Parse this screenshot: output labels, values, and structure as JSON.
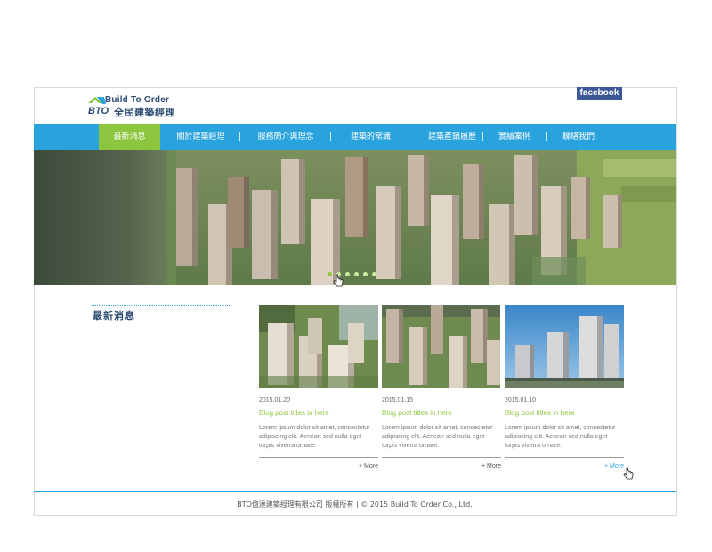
{
  "brand": {
    "name_en": "Build To Order",
    "short": "BTO",
    "name_zh": "全民建築經理",
    "colors": {
      "navy": "#2b4a72",
      "green": "#8cc63f",
      "blue": "#29a3dd"
    }
  },
  "social": {
    "facebook_label": "facebook"
  },
  "nav": {
    "items": [
      {
        "label": "最新消息",
        "active": true
      },
      {
        "label": "關於建築經理",
        "active": false
      },
      {
        "label": "服務簡介與理念",
        "active": false
      },
      {
        "label": "建築的常識",
        "active": false
      },
      {
        "label": "建築產銷履歷",
        "active": false
      },
      {
        "label": "實績案例",
        "active": false
      },
      {
        "label": "聯絡我們",
        "active": false
      }
    ]
  },
  "slider": {
    "slide_count": 6,
    "active_index": 0
  },
  "section": {
    "title": "最新消息"
  },
  "posts": [
    {
      "date": "2015.01.20",
      "title": "Blog post titles in here",
      "excerpt": "Lorem ipsum dolor sit amet, consectetur adipiscing elit. Aenean sed nulla eget turpis viverra ornare.",
      "more": "+ More"
    },
    {
      "date": "2015.01.15",
      "title": "Blog post titles in here",
      "excerpt": "Lorem ipsum dolor sit amet, consectetur adipiscing elit. Aenean sed nulla eget turpis viverra ornare.",
      "more": "+ More"
    },
    {
      "date": "2015.01.10",
      "title": "Blog post titles in here",
      "excerpt": "Lorem ipsum dolor sit amet, consectetur adipiscing elit. Aenean sed nulla eget turpis viverra ornare.",
      "more": "+ More"
    }
  ],
  "footer": {
    "text": "BTO億達建築經理有限公司  版權所有  |  © 2015 Build To Order Co., Ltd."
  }
}
